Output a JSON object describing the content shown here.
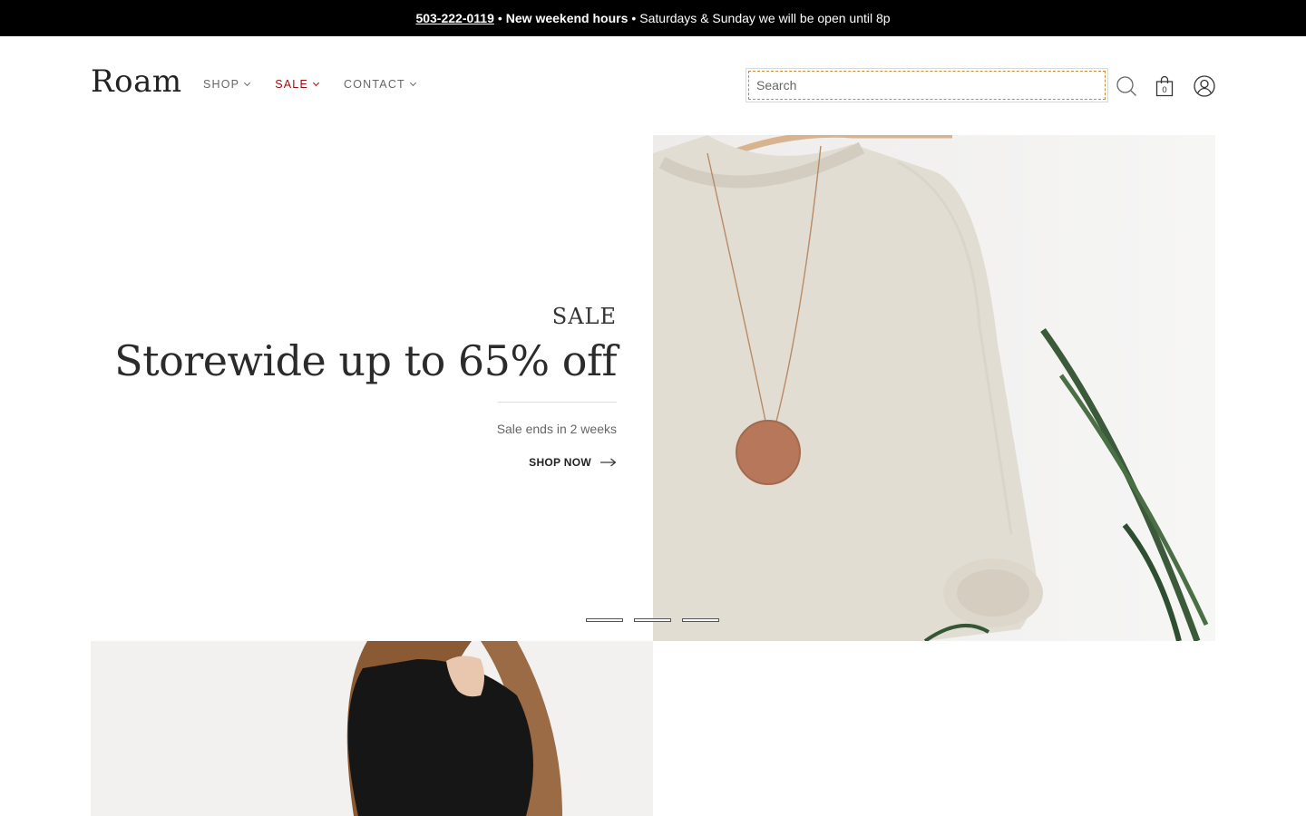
{
  "announcement": {
    "phone": "503-222-0119",
    "separator": "•",
    "headline": "New weekend hours",
    "details": "Saturdays & Sunday we will be open until 8p"
  },
  "header": {
    "logo": "Roam",
    "nav": [
      {
        "label": "SHOP",
        "icon": "chevron-down-icon"
      },
      {
        "label": "SALE",
        "icon": "chevron-down-icon",
        "color": "#9b0a0a"
      },
      {
        "label": "CONTACT",
        "icon": "chevron-down-icon"
      }
    ],
    "search": {
      "placeholder": "Search",
      "value": ""
    },
    "cart_count": "0",
    "icons": [
      "search-icon",
      "cart-icon",
      "account-icon"
    ]
  },
  "hero": {
    "eyebrow": "SALE",
    "title": "Storewide up to 65% off",
    "subtitle": "Sale ends in 2 weeks",
    "cta_label": "SHOP NOW",
    "slides": 3
  },
  "colors": {
    "announcement_bg": "#000000",
    "sale_accent": "#9b0a0a",
    "text": "#222222"
  }
}
